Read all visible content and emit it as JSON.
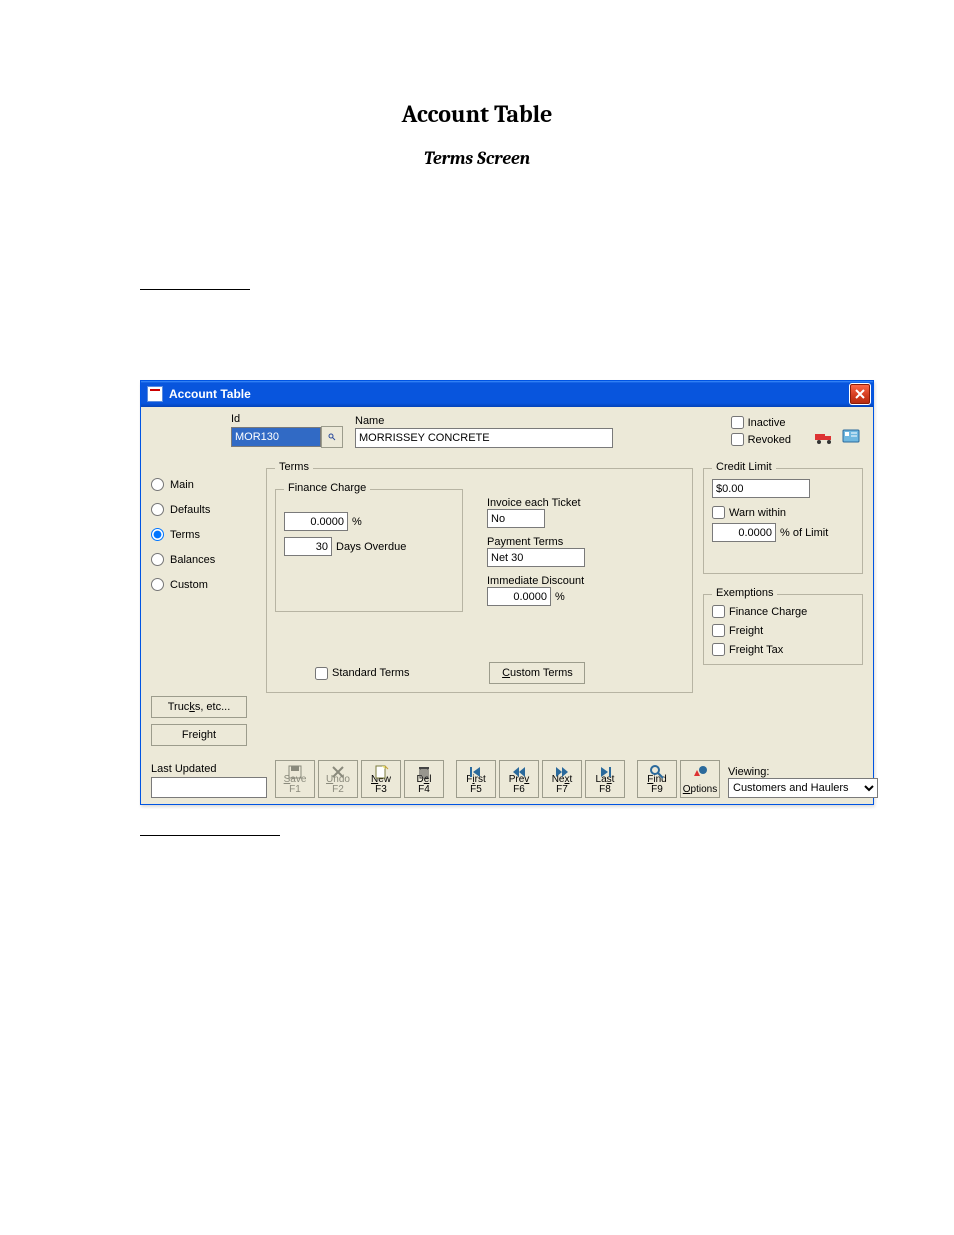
{
  "document": {
    "title": "Account Table",
    "subtitle": "Terms Screen"
  },
  "window": {
    "title": "Account Table"
  },
  "header": {
    "id_label": "Id",
    "id_value": "MOR130",
    "name_label": "Name",
    "name_value": "MORRISSEY CONCRETE",
    "inactive_label": "Inactive",
    "revoked_label": "Revoked"
  },
  "nav": {
    "main": "Main",
    "defaults": "Defaults",
    "terms": "Terms",
    "balances": "Balances",
    "custom": "Custom",
    "trucks_btn": "Trucks, etc...",
    "freight_btn": "Freight"
  },
  "terms": {
    "group_title": "Terms",
    "finance_title": "Finance Charge",
    "finance_rate": "0.0000",
    "finance_pct": "%",
    "finance_days": "30",
    "finance_days_label": "Days Overdue",
    "invoice_each_label": "Invoice each Ticket",
    "invoice_each_value": "No",
    "payment_terms_label": "Payment Terms",
    "payment_terms_value": "Net 30",
    "immediate_discount_label": "Immediate Discount",
    "immediate_discount_value": "0.0000",
    "immediate_discount_pct": "%",
    "standard_terms_label": "Standard Terms",
    "custom_terms_btn": "Custom Terms"
  },
  "credit": {
    "group_title": "Credit Limit",
    "limit_value": "$0.00",
    "warn_label": "Warn within",
    "warn_value": "0.0000",
    "warn_suffix": "% of Limit"
  },
  "exemptions": {
    "group_title": "Exemptions",
    "finance_charge": "Finance Charge",
    "freight": "Freight",
    "freight_tax": "Freight Tax"
  },
  "footer": {
    "last_updated_label": "Last Updated",
    "last_updated_value": "",
    "viewing_label": "Viewing:",
    "viewing_value": "Customers and Haulers"
  },
  "toolbar": {
    "save": "Save F1",
    "undo": "Undo F2",
    "new": "New F3",
    "del": "Del F4",
    "first": "First F5",
    "prev": "Prev F6",
    "next": "Next F7",
    "last": "Last F8",
    "find": "Find F9",
    "options": "Options"
  }
}
